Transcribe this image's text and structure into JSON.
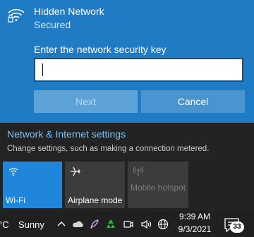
{
  "network": {
    "name": "Hidden Network",
    "status": "Secured",
    "key_label": "Enter the network security key",
    "key_value": "",
    "next_label": "Next",
    "cancel_label": "Cancel"
  },
  "settings": {
    "title": "Network & Internet settings",
    "description": "Change settings, such as making a connection metered."
  },
  "quick_actions": [
    {
      "label": "Wi-Fi",
      "icon": "wifi-icon",
      "active": true
    },
    {
      "label": "Airplane mode",
      "icon": "airplane-icon",
      "active": false
    },
    {
      "label": "Mobile hotspot",
      "icon": "hotspot-icon",
      "active": false,
      "disabled": true
    }
  ],
  "taskbar": {
    "weather_temp": "°C",
    "weather_condition": "Sunny",
    "time": "9:39 AM",
    "date": "9/3/2021",
    "notification_count": "33",
    "tray_icons": [
      "chevron-up-icon",
      "onedrive-icon",
      "feather-icon",
      "recycle-icon",
      "meet-now-icon",
      "volume-icon",
      "globe-icon"
    ]
  },
  "colors": {
    "accent": "#1e7bc4",
    "tile_active": "#1f86d9",
    "link": "#7cc1f2"
  }
}
